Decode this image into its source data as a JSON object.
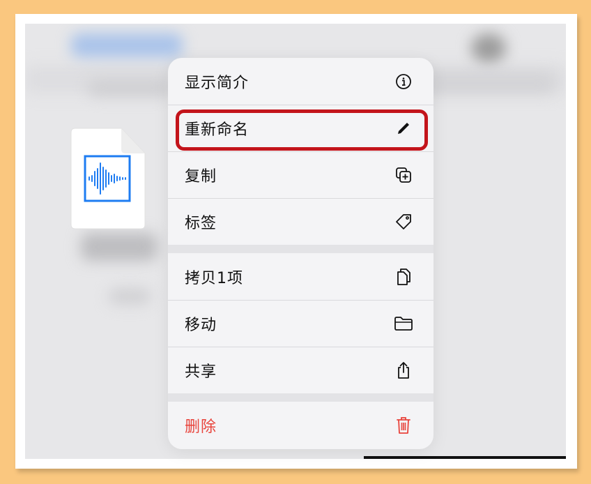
{
  "menu": {
    "items": [
      {
        "label": "显示简介",
        "icon": "info-circle-icon"
      },
      {
        "label": "重新命名",
        "icon": "pencil-icon"
      },
      {
        "label": "复制",
        "icon": "duplicate-icon"
      },
      {
        "label": "标签",
        "icon": "tag-icon"
      },
      {
        "label": "拷贝1项",
        "icon": "copy-doc-icon"
      },
      {
        "label": "移动",
        "icon": "folder-icon"
      },
      {
        "label": "共享",
        "icon": "share-icon"
      },
      {
        "label": "删除",
        "icon": "trash-icon"
      }
    ]
  },
  "file": {
    "icon": "audio-file-icon"
  },
  "colors": {
    "background": "#FAC77F",
    "highlight": "#C3141B",
    "destructive": "#E8433B",
    "accent": "#1E7CF2"
  }
}
